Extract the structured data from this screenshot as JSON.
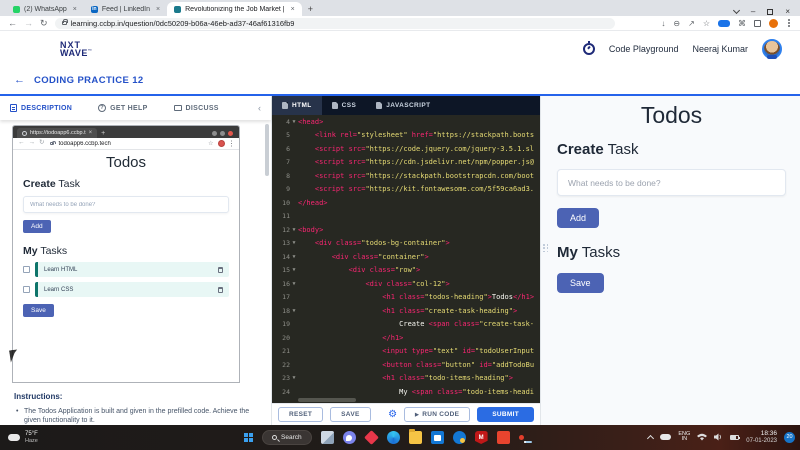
{
  "browser": {
    "tabs": [
      {
        "label": "(2) WhatsApp"
      },
      {
        "label": "Feed | LinkedIn"
      },
      {
        "label": "Revolutionizing the Job Market |"
      }
    ],
    "url": "learning.ccbp.in/question/0dc50209-b06a-46eb-ad37-46af61316fb9"
  },
  "header": {
    "brand_top": "NXT",
    "brand_bottom": "WAVE",
    "playground": "Code Playground",
    "user": "Neeraj Kumar"
  },
  "subheader": {
    "title": "CODING PRACTICE 12"
  },
  "panel": {
    "tabs": [
      "DESCRIPTION",
      "GET HELP",
      "DISCUSS"
    ],
    "preview": {
      "tab_title": "https://todoapp6.ccbp.t",
      "url": "todoapp6.ccbp.tech",
      "title": "Todos",
      "create_bold": "Create",
      "create_rest": " Task",
      "placeholder": "What needs to be done?",
      "add": "Add",
      "my_bold": "My",
      "my_rest": " Tasks",
      "tasks": [
        "Learn HTML",
        "Learn CSS"
      ],
      "save": "Save"
    },
    "instructions_title": "Instructions:",
    "instructions": "The Todos Application is built and given in the prefilled code. Achieve the given functionality to it."
  },
  "editor": {
    "tabs": [
      "HTML",
      "CSS",
      "JAVASCRIPT"
    ],
    "lines": [
      {
        "n": 4,
        "fold": true,
        "seg": [
          [
            "t",
            "<head>"
          ]
        ]
      },
      {
        "n": 5,
        "fold": false,
        "seg": [
          [
            "p",
            "    "
          ],
          [
            "t",
            "<link rel="
          ],
          [
            "s",
            "\"stylesheet\""
          ],
          [
            "t",
            " href="
          ],
          [
            "s",
            "\"https://stackpath.boots"
          ]
        ]
      },
      {
        "n": 6,
        "fold": false,
        "seg": [
          [
            "p",
            "    "
          ],
          [
            "t",
            "<script src="
          ],
          [
            "s",
            "\"https://code.jquery.com/jquery-3.5.1.sl"
          ]
        ]
      },
      {
        "n": 7,
        "fold": false,
        "seg": [
          [
            "p",
            "    "
          ],
          [
            "t",
            "<script src="
          ],
          [
            "s",
            "\"https://cdn.jsdelivr.net/npm/popper.js@"
          ]
        ]
      },
      {
        "n": 8,
        "fold": false,
        "seg": [
          [
            "p",
            "    "
          ],
          [
            "t",
            "<script src="
          ],
          [
            "s",
            "\"https://stackpath.bootstrapcdn.com/boot"
          ]
        ]
      },
      {
        "n": 9,
        "fold": false,
        "seg": [
          [
            "p",
            "    "
          ],
          [
            "t",
            "<script src="
          ],
          [
            "s",
            "\"https://kit.fontawesome.com/5f59ca6ad3."
          ]
        ]
      },
      {
        "n": 10,
        "fold": false,
        "seg": [
          [
            "t",
            "</head>"
          ]
        ]
      },
      {
        "n": 11,
        "fold": false,
        "seg": []
      },
      {
        "n": 12,
        "fold": true,
        "seg": [
          [
            "t",
            "<body>"
          ]
        ]
      },
      {
        "n": 13,
        "fold": true,
        "seg": [
          [
            "p",
            "    "
          ],
          [
            "t",
            "<div class="
          ],
          [
            "s",
            "\"todos-bg-container\""
          ],
          [
            "t",
            ">"
          ]
        ]
      },
      {
        "n": 14,
        "fold": true,
        "seg": [
          [
            "p",
            "        "
          ],
          [
            "t",
            "<div class="
          ],
          [
            "s",
            "\"container\""
          ],
          [
            "t",
            ">"
          ]
        ]
      },
      {
        "n": 15,
        "fold": true,
        "seg": [
          [
            "p",
            "            "
          ],
          [
            "t",
            "<div class="
          ],
          [
            "s",
            "\"row\""
          ],
          [
            "t",
            ">"
          ]
        ]
      },
      {
        "n": 16,
        "fold": true,
        "seg": [
          [
            "p",
            "                "
          ],
          [
            "t",
            "<div class="
          ],
          [
            "s",
            "\"col-12\""
          ],
          [
            "t",
            ">"
          ]
        ]
      },
      {
        "n": 17,
        "fold": false,
        "seg": [
          [
            "p",
            "                    "
          ],
          [
            "t",
            "<h1 class="
          ],
          [
            "s",
            "\"todos-heading\""
          ],
          [
            "t",
            ">"
          ],
          [
            "p",
            "Todos"
          ],
          [
            "t",
            "</h1>"
          ]
        ]
      },
      {
        "n": 18,
        "fold": true,
        "seg": [
          [
            "p",
            "                    "
          ],
          [
            "t",
            "<h1 class="
          ],
          [
            "s",
            "\"create-task-heading\""
          ],
          [
            "t",
            ">"
          ]
        ]
      },
      {
        "n": 19,
        "fold": false,
        "seg": [
          [
            "p",
            "                        Create "
          ],
          [
            "t",
            "<span class="
          ],
          [
            "s",
            "\"create-task-"
          ]
        ]
      },
      {
        "n": 20,
        "fold": false,
        "seg": [
          [
            "p",
            "                    "
          ],
          [
            "t",
            "</h1>"
          ]
        ]
      },
      {
        "n": 21,
        "fold": false,
        "seg": [
          [
            "p",
            "                    "
          ],
          [
            "t",
            "<input type="
          ],
          [
            "s",
            "\"text\""
          ],
          [
            "t",
            " id="
          ],
          [
            "s",
            "\"todoUserInput"
          ]
        ]
      },
      {
        "n": 22,
        "fold": false,
        "seg": [
          [
            "p",
            "                    "
          ],
          [
            "t",
            "<button class="
          ],
          [
            "s",
            "\"button\""
          ],
          [
            "t",
            " id="
          ],
          [
            "s",
            "\"addTodoBu"
          ]
        ]
      },
      {
        "n": 23,
        "fold": true,
        "seg": [
          [
            "p",
            "                    "
          ],
          [
            "t",
            "<h1 class="
          ],
          [
            "s",
            "\"todo-items-heading\""
          ],
          [
            "t",
            ">"
          ]
        ]
      },
      {
        "n": 24,
        "fold": false,
        "seg": [
          [
            "p",
            "                        My "
          ],
          [
            "t",
            "<span class="
          ],
          [
            "s",
            "\"todo-items-headi"
          ]
        ]
      }
    ]
  },
  "footer": {
    "reset": "RESET",
    "save": "SAVE",
    "run": "RUN CODE",
    "submit": "SUBMIT"
  },
  "output": {
    "title": "Todos",
    "create_bold": "Create",
    "create_rest": " Task",
    "placeholder": "What needs to be done?",
    "add": "Add",
    "my_bold": "My",
    "my_rest": " Tasks",
    "save": "Save"
  },
  "taskbar": {
    "temp": "75°F",
    "cond": "Haze",
    "search": "Search",
    "lang_top": "ENG",
    "lang_bottom": "IN",
    "time": "18:36",
    "date": "07-01-2023",
    "badge": "20"
  }
}
